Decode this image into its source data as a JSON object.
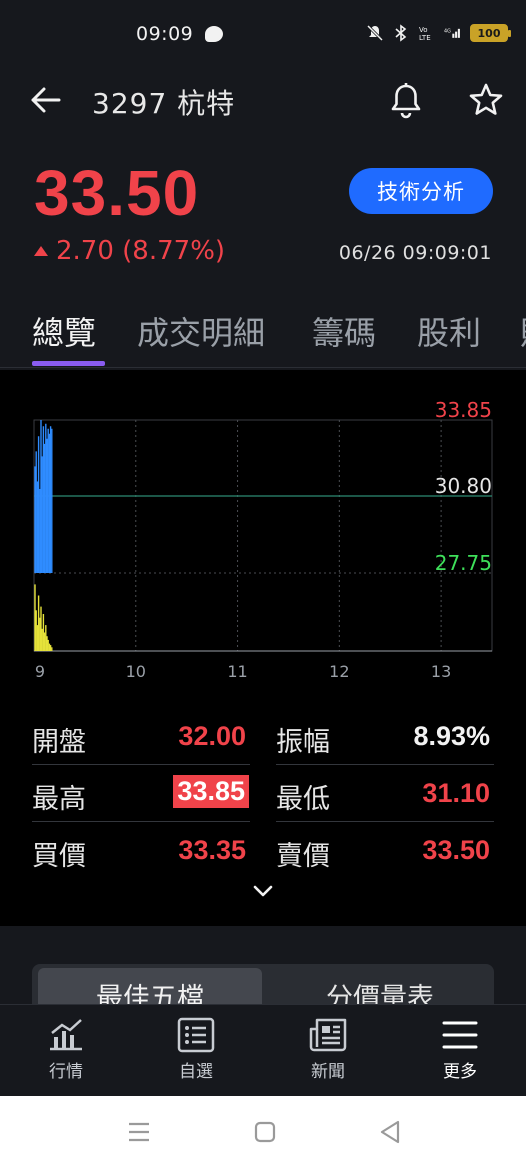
{
  "status_bar": {
    "time": "09:09",
    "battery": "100"
  },
  "header": {
    "title": "3297 杭特"
  },
  "quote": {
    "price": "33.50",
    "change": "2.70 (8.77%)",
    "technical_button": "技術分析",
    "timestamp": "06/26 09:09:01",
    "up_color": "#f0434a"
  },
  "tabs": [
    {
      "label": "總覽"
    },
    {
      "label": "成交明細"
    },
    {
      "label": "籌碼"
    },
    {
      "label": "股利"
    },
    {
      "label": "財"
    }
  ],
  "chart_data": {
    "type": "line",
    "price_levels": {
      "high": "33.85",
      "mid": "30.80",
      "low": "27.75"
    },
    "x_ticks": [
      "9",
      "10",
      "11",
      "12",
      "13"
    ],
    "price_series_color": "#2f8cff",
    "volume_series_color": "#e6e23a",
    "high_label_color": "#f0434a",
    "low_label_color": "#3ee05a",
    "price_intraday": [
      32.0,
      32.6,
      31.4,
      33.2,
      31.1,
      33.85,
      32.4,
      33.6,
      32.9,
      33.7,
      33.1,
      33.5,
      33.3,
      33.6,
      33.5
    ],
    "volume_intraday": [
      0.9,
      0.55,
      0.35,
      0.75,
      0.45,
      0.6,
      0.3,
      0.5,
      0.25,
      0.35,
      0.2,
      0.15,
      0.1,
      0.08,
      0.05
    ]
  },
  "stats": {
    "open_label": "開盤",
    "open_value": "32.00",
    "amplitude_label": "振幅",
    "amplitude_value": "8.93%",
    "high_label": "最高",
    "high_value": "33.85",
    "low_label": "最低",
    "low_value": "31.10",
    "bid_label": "買價",
    "bid_value": "33.35",
    "ask_label": "賣價",
    "ask_value": "33.50"
  },
  "order_book_tabs": {
    "best_five": "最佳五檔",
    "price_volume": "分價量表"
  },
  "bottom_nav": [
    {
      "label": "行情",
      "icon": "chart-icon"
    },
    {
      "label": "自選",
      "icon": "list-icon"
    },
    {
      "label": "新聞",
      "icon": "news-icon"
    },
    {
      "label": "更多",
      "icon": "menu-icon"
    }
  ]
}
